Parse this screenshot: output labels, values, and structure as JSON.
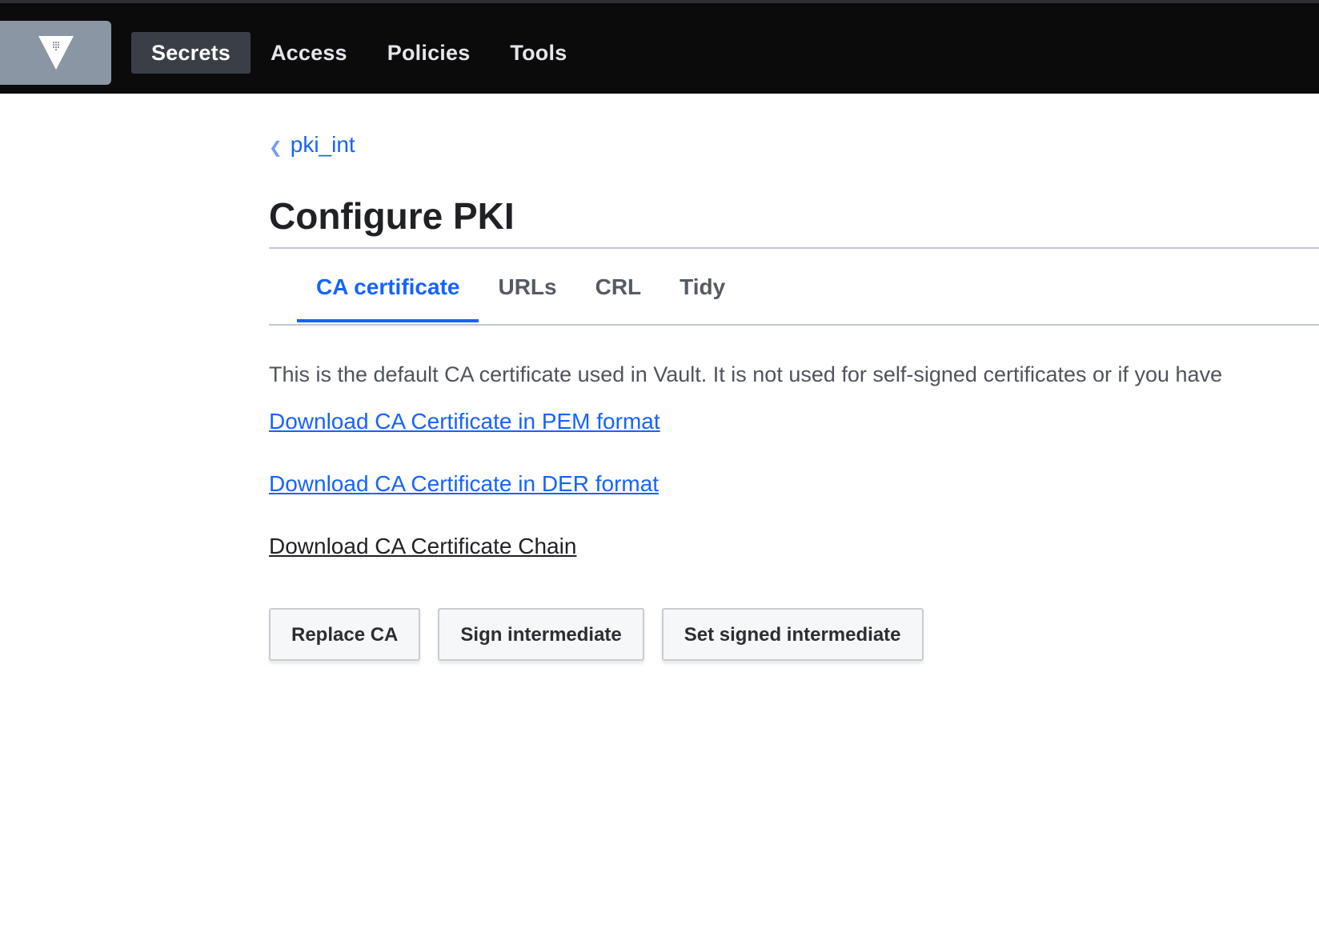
{
  "nav": {
    "logo_icon": "vault-logo-icon",
    "items": [
      {
        "label": "Secrets",
        "active": true
      },
      {
        "label": "Access",
        "active": false
      },
      {
        "label": "Policies",
        "active": false
      },
      {
        "label": "Tools",
        "active": false
      }
    ]
  },
  "breadcrumb": {
    "icon": "chevron-left-icon",
    "label": "pki_int"
  },
  "page": {
    "title": "Configure PKI"
  },
  "tabs": [
    {
      "label": "CA certificate",
      "active": true
    },
    {
      "label": "URLs",
      "active": false
    },
    {
      "label": "CRL",
      "active": false
    },
    {
      "label": "Tidy",
      "active": false
    }
  ],
  "ca": {
    "description": "This is the default CA certificate used in Vault. It is not used for self-signed certificates or if you have",
    "links": {
      "pem": "Download CA Certificate in PEM format",
      "der": "Download CA Certificate in DER format",
      "chain": "Download CA Certificate Chain"
    },
    "buttons": {
      "replace": "Replace CA",
      "sign": "Sign intermediate",
      "set_signed": "Set signed intermediate"
    }
  },
  "colors": {
    "accent": "#1563ff",
    "topbar": "#0b0b0c",
    "logo_bg": "#8a96a4"
  }
}
